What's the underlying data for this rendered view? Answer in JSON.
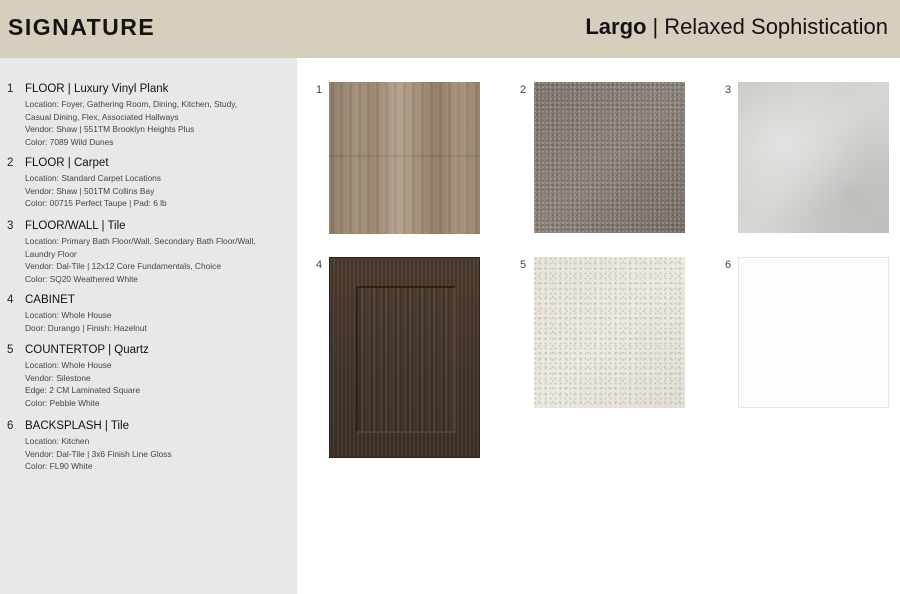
{
  "header": {
    "brand": "SIGNATURE",
    "plan_name": "Largo",
    "separator": "|",
    "tagline": "Relaxed Sophistication"
  },
  "items": [
    {
      "number": "1",
      "heading": "FLOOR | Luxury Vinyl Plank",
      "lines": [
        "Location: Foyer, Gathering Room, Dining, Kitchen, Study,",
        "Casual Dining, Flex, Associated Hallways",
        "Vendor: Shaw | 551TM Brooklyn Heights Plus",
        "Color: 7089 Wild Dunes"
      ]
    },
    {
      "number": "2",
      "heading": "FLOOR | Carpet",
      "lines": [
        "Location: Standard Carpet Locations",
        "Vendor: Shaw | 501TM Collins Bay",
        "Color: 00715 Perfect Taupe | Pad: 6 lb"
      ]
    },
    {
      "number": "3",
      "heading": "FLOOR/WALL | Tile",
      "lines": [
        "Location: Primary Bath Floor/Wall, Secondary Bath Floor/Wall,",
        "Laundry Floor",
        "Vendor: Dal-Tile | 12x12 Core Fundamentals, Choice",
        "Color: SQ20 Weathered White"
      ]
    },
    {
      "number": "4",
      "heading": "CABINET",
      "lines": [
        "Location: Whole House",
        "Door: Durango | Finish: Hazelnut"
      ]
    },
    {
      "number": "5",
      "heading": "COUNTERTOP | Quartz",
      "lines": [
        "Location: Whole House",
        "Vendor: Silestone",
        "Edge: 2 CM Laminated Square",
        "Color: Pebble White"
      ]
    },
    {
      "number": "6",
      "heading": "BACKSPLASH | Tile",
      "lines": [
        "Location: Kitchen",
        "Vendor: Dal-Tile | 3x6 Finish Line Gloss",
        "Color: FL90 White"
      ]
    }
  ],
  "swatches": [
    {
      "number": "1",
      "texture": "wood-plank-swatch",
      "color": "#a08e77"
    },
    {
      "number": "2",
      "texture": "carpet-swatch",
      "color": "#857c73"
    },
    {
      "number": "3",
      "texture": "stone-tile-swatch",
      "color": "#cfcfcc"
    },
    {
      "number": "4",
      "texture": "cabinet-door-swatch",
      "color": "#45352a"
    },
    {
      "number": "5",
      "texture": "quartz-swatch",
      "color": "#e8e4da"
    },
    {
      "number": "6",
      "texture": "white-tile-swatch",
      "color": "#fdfdfb"
    }
  ],
  "colors": {
    "header_band": "#d6cfbd",
    "sidebar": "#e8e8ea"
  }
}
